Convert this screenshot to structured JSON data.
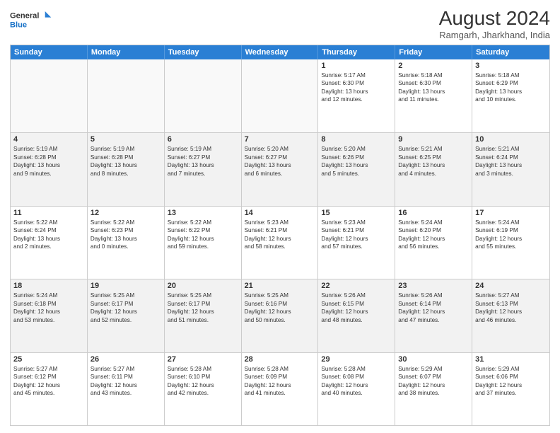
{
  "logo": {
    "line1": "General",
    "line2": "Blue"
  },
  "title": "August 2024",
  "location": "Ramgarh, Jharkhand, India",
  "weekdays": [
    "Sunday",
    "Monday",
    "Tuesday",
    "Wednesday",
    "Thursday",
    "Friday",
    "Saturday"
  ],
  "weeks": [
    [
      {
        "day": "",
        "info": ""
      },
      {
        "day": "",
        "info": ""
      },
      {
        "day": "",
        "info": ""
      },
      {
        "day": "",
        "info": ""
      },
      {
        "day": "1",
        "info": "Sunrise: 5:17 AM\nSunset: 6:30 PM\nDaylight: 13 hours\nand 12 minutes."
      },
      {
        "day": "2",
        "info": "Sunrise: 5:18 AM\nSunset: 6:30 PM\nDaylight: 13 hours\nand 11 minutes."
      },
      {
        "day": "3",
        "info": "Sunrise: 5:18 AM\nSunset: 6:29 PM\nDaylight: 13 hours\nand 10 minutes."
      }
    ],
    [
      {
        "day": "4",
        "info": "Sunrise: 5:19 AM\nSunset: 6:28 PM\nDaylight: 13 hours\nand 9 minutes."
      },
      {
        "day": "5",
        "info": "Sunrise: 5:19 AM\nSunset: 6:28 PM\nDaylight: 13 hours\nand 8 minutes."
      },
      {
        "day": "6",
        "info": "Sunrise: 5:19 AM\nSunset: 6:27 PM\nDaylight: 13 hours\nand 7 minutes."
      },
      {
        "day": "7",
        "info": "Sunrise: 5:20 AM\nSunset: 6:27 PM\nDaylight: 13 hours\nand 6 minutes."
      },
      {
        "day": "8",
        "info": "Sunrise: 5:20 AM\nSunset: 6:26 PM\nDaylight: 13 hours\nand 5 minutes."
      },
      {
        "day": "9",
        "info": "Sunrise: 5:21 AM\nSunset: 6:25 PM\nDaylight: 13 hours\nand 4 minutes."
      },
      {
        "day": "10",
        "info": "Sunrise: 5:21 AM\nSunset: 6:24 PM\nDaylight: 13 hours\nand 3 minutes."
      }
    ],
    [
      {
        "day": "11",
        "info": "Sunrise: 5:22 AM\nSunset: 6:24 PM\nDaylight: 13 hours\nand 2 minutes."
      },
      {
        "day": "12",
        "info": "Sunrise: 5:22 AM\nSunset: 6:23 PM\nDaylight: 13 hours\nand 0 minutes."
      },
      {
        "day": "13",
        "info": "Sunrise: 5:22 AM\nSunset: 6:22 PM\nDaylight: 12 hours\nand 59 minutes."
      },
      {
        "day": "14",
        "info": "Sunrise: 5:23 AM\nSunset: 6:21 PM\nDaylight: 12 hours\nand 58 minutes."
      },
      {
        "day": "15",
        "info": "Sunrise: 5:23 AM\nSunset: 6:21 PM\nDaylight: 12 hours\nand 57 minutes."
      },
      {
        "day": "16",
        "info": "Sunrise: 5:24 AM\nSunset: 6:20 PM\nDaylight: 12 hours\nand 56 minutes."
      },
      {
        "day": "17",
        "info": "Sunrise: 5:24 AM\nSunset: 6:19 PM\nDaylight: 12 hours\nand 55 minutes."
      }
    ],
    [
      {
        "day": "18",
        "info": "Sunrise: 5:24 AM\nSunset: 6:18 PM\nDaylight: 12 hours\nand 53 minutes."
      },
      {
        "day": "19",
        "info": "Sunrise: 5:25 AM\nSunset: 6:17 PM\nDaylight: 12 hours\nand 52 minutes."
      },
      {
        "day": "20",
        "info": "Sunrise: 5:25 AM\nSunset: 6:17 PM\nDaylight: 12 hours\nand 51 minutes."
      },
      {
        "day": "21",
        "info": "Sunrise: 5:25 AM\nSunset: 6:16 PM\nDaylight: 12 hours\nand 50 minutes."
      },
      {
        "day": "22",
        "info": "Sunrise: 5:26 AM\nSunset: 6:15 PM\nDaylight: 12 hours\nand 48 minutes."
      },
      {
        "day": "23",
        "info": "Sunrise: 5:26 AM\nSunset: 6:14 PM\nDaylight: 12 hours\nand 47 minutes."
      },
      {
        "day": "24",
        "info": "Sunrise: 5:27 AM\nSunset: 6:13 PM\nDaylight: 12 hours\nand 46 minutes."
      }
    ],
    [
      {
        "day": "25",
        "info": "Sunrise: 5:27 AM\nSunset: 6:12 PM\nDaylight: 12 hours\nand 45 minutes."
      },
      {
        "day": "26",
        "info": "Sunrise: 5:27 AM\nSunset: 6:11 PM\nDaylight: 12 hours\nand 43 minutes."
      },
      {
        "day": "27",
        "info": "Sunrise: 5:28 AM\nSunset: 6:10 PM\nDaylight: 12 hours\nand 42 minutes."
      },
      {
        "day": "28",
        "info": "Sunrise: 5:28 AM\nSunset: 6:09 PM\nDaylight: 12 hours\nand 41 minutes."
      },
      {
        "day": "29",
        "info": "Sunrise: 5:28 AM\nSunset: 6:08 PM\nDaylight: 12 hours\nand 40 minutes."
      },
      {
        "day": "30",
        "info": "Sunrise: 5:29 AM\nSunset: 6:07 PM\nDaylight: 12 hours\nand 38 minutes."
      },
      {
        "day": "31",
        "info": "Sunrise: 5:29 AM\nSunset: 6:06 PM\nDaylight: 12 hours\nand 37 minutes."
      }
    ]
  ]
}
